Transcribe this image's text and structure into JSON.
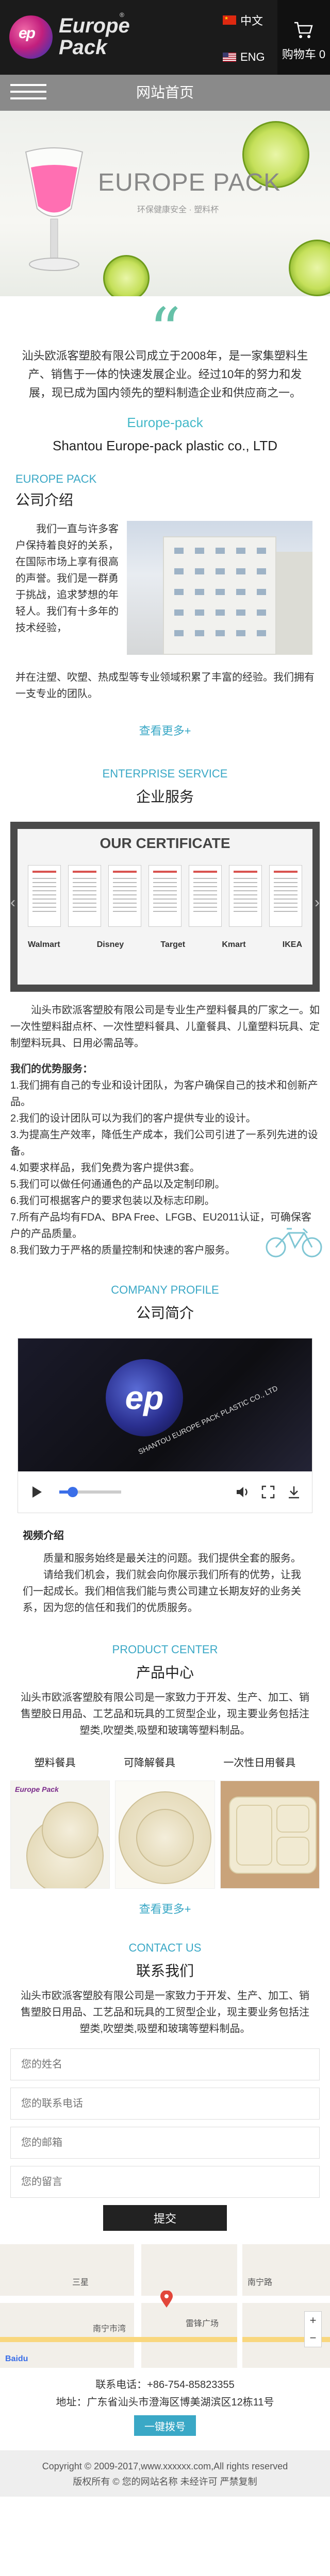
{
  "header": {
    "logo_line1": "Europe",
    "logo_line2": "Pack",
    "logo_mark": "ep",
    "lang_zh": "中文",
    "lang_en": "ENG",
    "cart_label": "购物车 0",
    "cart_icon": "cart-icon",
    "menu_icon": "hamburger-icon"
  },
  "nav": {
    "title": "网站首页"
  },
  "banner": {
    "title": "EUROPE PACK",
    "subtitle": "环保健康安全 · 塑料杯"
  },
  "intro": {
    "text": "汕头欧派客塑胶有限公司成立于2008年，是一家集塑料生产、销售于一体的快速发展企业。经过10年的努力和发展，现已成为国内领先的塑料制造企业和供应商之一。",
    "en_name_1": "Europe-pack",
    "en_name_2": "Shantou Europe-pack plastic co., LTD"
  },
  "about": {
    "en_title": "EUROPE PACK",
    "cn_title": "公司介绍",
    "text_side": "我们一直与许多客户保持着良好的关系，在国际市场上享有很高的声誉。我们是一群勇于挑战，追求梦想的年轻人。我们有十多年的技术经验，",
    "text_full": "并在注塑、吹塑、热成型等专业领域积累了丰富的经验。我们拥有一支专业的团队。",
    "more": "查看更多+"
  },
  "service": {
    "en_title": "ENTERPRISE SERVICE",
    "cn_title": "企业服务",
    "cert_title": "OUR CERTIFICATE",
    "brands": [
      "Walmart",
      "Disney",
      "Target",
      "Kmart",
      "IKEA"
    ],
    "lead": "汕头市欧派客塑胶有限公司是专业生产塑料餐具的厂家之一。如一次性塑料甜点杯、一次性塑料餐具、儿童餐具、儿童塑料玩具、定制塑料玩具、日用必需品等。",
    "adv_title": "我们的优势服务：",
    "advantages": [
      "1.我们拥有自己的专业和设计团队，为客户确保自己的技术和创新产品。",
      "2.我们的设计团队可以为我们的客户提供专业的设计。",
      "3.为提高生产效率，降低生产成本，我们公司引进了一系列先进的设备。",
      "4.如要求样品，我们免费为客户提供3套。",
      "5.我们可以做任何通通色的产品以及定制印刷。",
      "6.我们可根据客户的要求包装以及标志印刷。",
      "7.所有产品均有FDA、BPA Free、LFGB、EU2011认证，可确保客户的产品质量。",
      "8.我们致力于严格的质量控制和快速的客户服务。"
    ]
  },
  "profile": {
    "en_title": "COMPANY PROFILE",
    "cn_title": "公司简介",
    "video_mark": "ep",
    "video_caption": "SHANTOU EUROPE PACK PLASTIC CO., LTD",
    "video_progress": 0.22,
    "h": "视频介绍",
    "p1": "质量和服务始终是最关注的问题。我们提供全套的服务。",
    "p2": "请给我们机会，我们就会向你展示我们所有的优势，让我们一起成长。我们相信我们能与贵公司建立长期友好的业务关系，因为您的信任和我们的优质服务。"
  },
  "products": {
    "en_title": "PRODUCT CENTER",
    "cn_title": "产品中心",
    "lead": "汕头市欧派客塑胶有限公司是一家致力于开发、生产、加工、销售塑胶日用品、工艺品和玩具的工贸型企业，现主要业务包括注塑类,吹塑类,吸塑和玻璃等塑料制品。",
    "tabs": [
      "塑料餐具",
      "可降解餐具",
      "一次性日用餐具"
    ],
    "items": [
      {
        "label": "Europe Pack"
      },
      {
        "label": ""
      },
      {
        "label": ""
      }
    ],
    "more": "查看更多+"
  },
  "contact": {
    "en_title": "CONTACT US",
    "cn_title": "联系我们",
    "lead": "汕头市欧派客塑胶有限公司是一家致力于开发、生产、加工、销售塑胶日用品、工艺品和玩具的工贸型企业，现主要业务包括注塑类,吹塑类,吸塑和玻璃等塑料制品。",
    "placeholders": {
      "name": "您的姓名",
      "phone": "您的联系电话",
      "email": "您的邮箱",
      "message": "您的留言"
    },
    "submit": "提交",
    "map_labels": [
      "三星",
      "南宁市湾",
      "雷锋广场",
      "南宁路"
    ],
    "baidu": "Baidu",
    "phone": "联系电话：+86-754-85823355",
    "address": "地址：广东省汕头市澄海区博美湖滨区12栋11号",
    "nav_btn": "一键拨号"
  },
  "footer": {
    "copyright": "Copyright © 2009-2017,www.xxxxxx.com,All rights reserved",
    "disclaimer": "版权所有 © 您的网站名称 未经许可 严禁复制"
  }
}
